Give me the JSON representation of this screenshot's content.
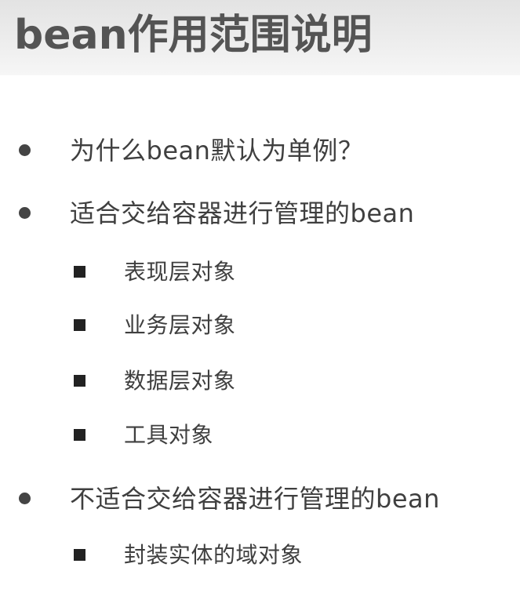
{
  "title": "bean作用范围说明",
  "colors": {
    "header_bg": "#e8e8e8",
    "title_text": "#545454",
    "body_text": "#3f3f3f",
    "bullet": "#444444"
  },
  "items": [
    {
      "level": 1,
      "text": "为什么bean默认为单例？"
    },
    {
      "level": 1,
      "text": "适合交给容器进行管理的bean"
    },
    {
      "level": 2,
      "text": "表现层对象"
    },
    {
      "level": 2,
      "text": "业务层对象"
    },
    {
      "level": 2,
      "text": "数据层对象"
    },
    {
      "level": 2,
      "text": "工具对象"
    },
    {
      "level": 1,
      "text": "不适合交给容器进行管理的bean"
    },
    {
      "level": 2,
      "text": "封装实体的域对象"
    }
  ]
}
